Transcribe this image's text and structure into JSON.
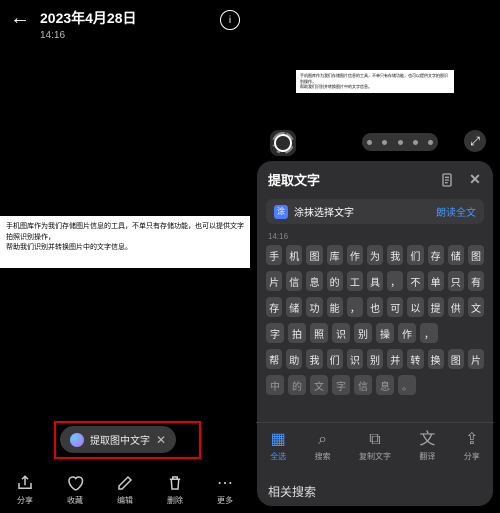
{
  "left": {
    "date": "2023年4月28日",
    "time": "14:16",
    "paper": {
      "line1": "手机图库作为我们存储图片信息的工具，不单只有存储功能，也可以提供文字拍照识别操作，",
      "line2": "帮助我们识别并转换图片中的文字信息。"
    },
    "pill_label": "提取图中文字",
    "bottom": {
      "share": "分享",
      "fav": "收藏",
      "edit": "编辑",
      "delete": "删除",
      "more": "更多"
    }
  },
  "right": {
    "mini": {
      "line1": "手机图库作为我们存储图片信息的工具，不单只有存储功能，也可以提供文字拍照识别操作，",
      "line2": "帮助我们识别并转换图片中的文字信息。"
    },
    "panel": {
      "title": "提取文字",
      "sub_label": "涂抹选择文字",
      "sub_badge": "涂",
      "read_all": "朗读全文",
      "top_time": "14:16",
      "rows": [
        [
          "手",
          "机",
          "图",
          "库",
          "作",
          "为",
          "我",
          "们",
          "存",
          "储",
          "图"
        ],
        [
          "片",
          "信",
          "息",
          "的",
          "工",
          "具",
          "，",
          "不",
          "单",
          "只",
          "有"
        ],
        [
          "存",
          "储",
          "功",
          "能",
          "，",
          "也",
          "可",
          "以",
          "提",
          "供",
          "文"
        ],
        [
          "字",
          "拍",
          "照",
          "识",
          "别",
          "操",
          "作",
          "，"
        ],
        [
          "帮",
          "助",
          "我",
          "们",
          "识",
          "别",
          "并",
          "转",
          "换",
          "图",
          "片"
        ],
        [
          "中",
          "的",
          "文",
          "字",
          "信",
          "息",
          "。"
        ]
      ],
      "tabs": {
        "select_all": "全选",
        "search": "搜索",
        "copy": "复制文字",
        "translate": "翻译",
        "share": "分享"
      },
      "footer": "相关搜索"
    }
  }
}
